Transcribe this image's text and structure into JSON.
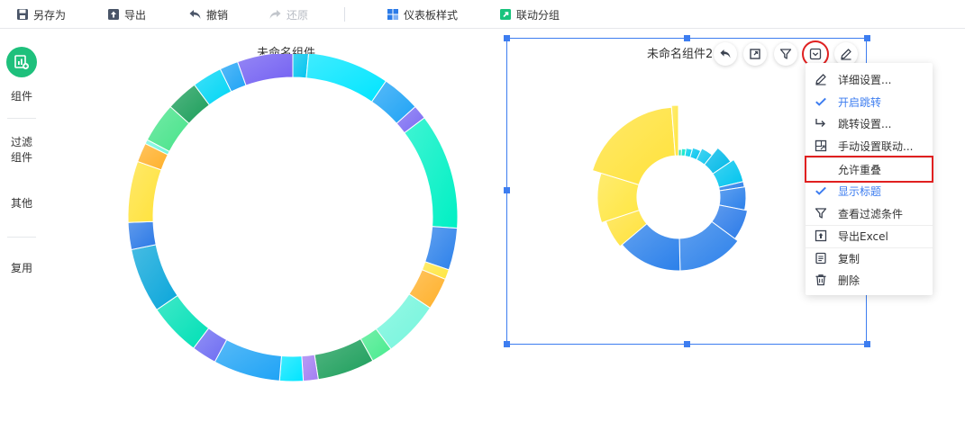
{
  "toolbar": {
    "save_as": "另存为",
    "export": "导出",
    "undo": "撤销",
    "redo": "还原",
    "dashboard_style": "仪表板样式",
    "linkage_group": "联动分组"
  },
  "rail": {
    "components": "组件",
    "filter_line1": "过滤",
    "filter_line2": "组件",
    "other": "其他",
    "reuse": "复用"
  },
  "widget_left": {
    "title": "未命名组件"
  },
  "widget_right": {
    "title": "未命名组件2"
  },
  "menu": {
    "items": [
      {
        "label": "详细设置...",
        "icon": "pencil-icon",
        "checked": false
      },
      {
        "label": "开启跳转",
        "icon": "check-icon",
        "checked": true
      },
      {
        "label": "跳转设置...",
        "icon": "jump-arrow-icon",
        "checked": false
      },
      {
        "label": "手动设置联动...",
        "icon": "link-window-icon",
        "checked": false
      },
      {
        "label": "允许重叠",
        "icon": "",
        "checked": false
      },
      {
        "label": "显示标题",
        "icon": "check-icon",
        "checked": true
      },
      {
        "label": "查看过滤条件",
        "icon": "filter-icon",
        "checked": false
      },
      {
        "label": "导出Excel",
        "icon": "export-icon",
        "checked": false
      },
      {
        "label": "复制",
        "icon": "copy-icon",
        "checked": false
      },
      {
        "label": "删除",
        "icon": "trash-icon",
        "checked": false
      }
    ]
  },
  "colors": {
    "accent": "#3d7df0",
    "highlight": "#e02020",
    "rail_green": "#1ec07c"
  },
  "chart_data": [
    {
      "type": "pie",
      "variant": "donut",
      "title": "未命名组件",
      "slices": [
        {
          "value": 2.2,
          "color": "#00c4ee"
        },
        {
          "value": 11.5,
          "color": "#00e5ff"
        },
        {
          "value": 5.4,
          "color": "#1fa3f5"
        },
        {
          "value": 2.0,
          "color": "#7b6bf2"
        },
        {
          "value": 16.3,
          "color": "#00f0c4"
        },
        {
          "value": 5.9,
          "color": "#2b80ea"
        },
        {
          "value": 1.4,
          "color": "#ffe640"
        },
        {
          "value": 4.5,
          "color": "#ffb02a"
        },
        {
          "value": 7.9,
          "color": "#74f5dc"
        },
        {
          "value": 3.0,
          "color": "#47eb8e"
        },
        {
          "value": 8.0,
          "color": "#1b9e5a"
        },
        {
          "value": 2.1,
          "color": "#a27cf2"
        },
        {
          "value": 3.3,
          "color": "#00e5ff"
        },
        {
          "value": 9.4,
          "color": "#1fa3f5"
        },
        {
          "value": 3.5,
          "color": "#6d6cf2"
        },
        {
          "value": 7.4,
          "color": "#00e0b6"
        },
        {
          "value": 9.1,
          "color": "#0aa6da"
        },
        {
          "value": 3.8,
          "color": "#2a78e6"
        },
        {
          "value": 8.6,
          "color": "#ffe23a"
        },
        {
          "value": 2.7,
          "color": "#ffb02a"
        },
        {
          "value": 0.6,
          "color": "#74f5dc"
        },
        {
          "value": 5.6,
          "color": "#47e38a"
        },
        {
          "value": 4.5,
          "color": "#1b9e5a"
        },
        {
          "value": 4.2,
          "color": "#00d6f5"
        },
        {
          "value": 2.6,
          "color": "#1fa3f5"
        },
        {
          "value": 7.8,
          "color": "#7360f2"
        }
      ]
    },
    {
      "type": "pie",
      "variant": "rose-donut",
      "title": "未命名组件2",
      "slices": [
        {
          "value": 1.0,
          "radius": 0.53,
          "color": "#19d6a4"
        },
        {
          "value": 1.4,
          "radius": 0.54,
          "color": "#00e6c8"
        },
        {
          "value": 2.0,
          "radius": 0.55,
          "color": "#00d0ee"
        },
        {
          "value": 2.6,
          "radius": 0.57,
          "color": "#00c4ee"
        },
        {
          "value": 3.5,
          "radius": 0.6,
          "color": "#0fc6ee"
        },
        {
          "value": 4.7,
          "radius": 0.7,
          "color": "#00b9e8"
        },
        {
          "value": 5.6,
          "radius": 0.74,
          "color": "#00c4ee"
        },
        {
          "value": 1.3,
          "radius": 0.74,
          "color": "#2b7ee8"
        },
        {
          "value": 5.4,
          "radius": 0.75,
          "color": "#2b80ea"
        },
        {
          "value": 6.9,
          "radius": 0.78,
          "color": "#2a7ae8"
        },
        {
          "value": 14.2,
          "radius": 0.82,
          "color": "#2b80ea"
        },
        {
          "value": 13.9,
          "radius": 0.82,
          "color": "#2b80ea"
        },
        {
          "value": 5.9,
          "radius": 0.85,
          "color": "#ffe23a"
        },
        {
          "value": 9.7,
          "radius": 0.9,
          "color": "#ffe640"
        },
        {
          "value": 18.6,
          "radius": 1.0,
          "color": "#ffe23a"
        },
        {
          "value": 1.2,
          "radius": 1.02,
          "color": "#ffe640"
        }
      ]
    }
  ]
}
